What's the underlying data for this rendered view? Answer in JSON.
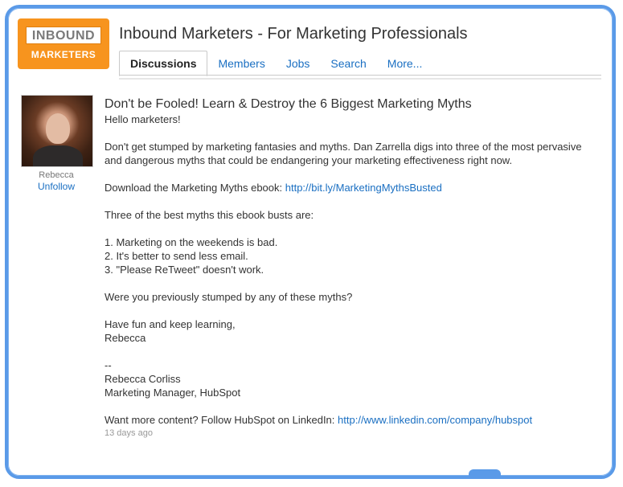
{
  "logo": {
    "top_text": "INBOUND",
    "bottom_text": "MARKETERS",
    "color": "#f7941e"
  },
  "group": {
    "title": "Inbound Marketers - For Marketing Professionals"
  },
  "tabs": [
    {
      "label": "Discussions",
      "active": true
    },
    {
      "label": "Members",
      "active": false
    },
    {
      "label": "Jobs",
      "active": false
    },
    {
      "label": "Search",
      "active": false
    },
    {
      "label": "More...",
      "active": false
    }
  ],
  "author": {
    "name": "Rebecca",
    "action": "Unfollow"
  },
  "post": {
    "title": "Don't be Fooled! Learn & Destroy the 6 Biggest Marketing Myths",
    "greeting": "Hello marketers!",
    "intro": "Don't get stumped by marketing fantasies and myths. Dan Zarrella digs into three of the most pervasive and dangerous myths that could be endangering your marketing effectiveness right now.",
    "download_text": "Download the Marketing Myths ebook:",
    "download_link": "http://bit.ly/MarketingMythsBusted",
    "list_intro": "Three of the best myths this ebook busts are:",
    "myths": [
      "1. Marketing on the weekends is bad.",
      "2. It's better to send less email.",
      "3. \"Please ReTweet\" doesn't work."
    ],
    "question": "Were you previously stumped by any of these myths?",
    "closing_line1": "Have fun and keep learning,",
    "closing_line2": "Rebecca",
    "separator": "--",
    "sig_name": "Rebecca Corliss",
    "sig_title": "Marketing Manager, HubSpot",
    "follow_text": "Want more content? Follow HubSpot on LinkedIn:",
    "follow_link": "http://www.linkedin.com/company/hubspot",
    "timestamp": "13 days ago"
  },
  "colors": {
    "frame": "#5a9ae8",
    "link": "#1a6fc2"
  }
}
